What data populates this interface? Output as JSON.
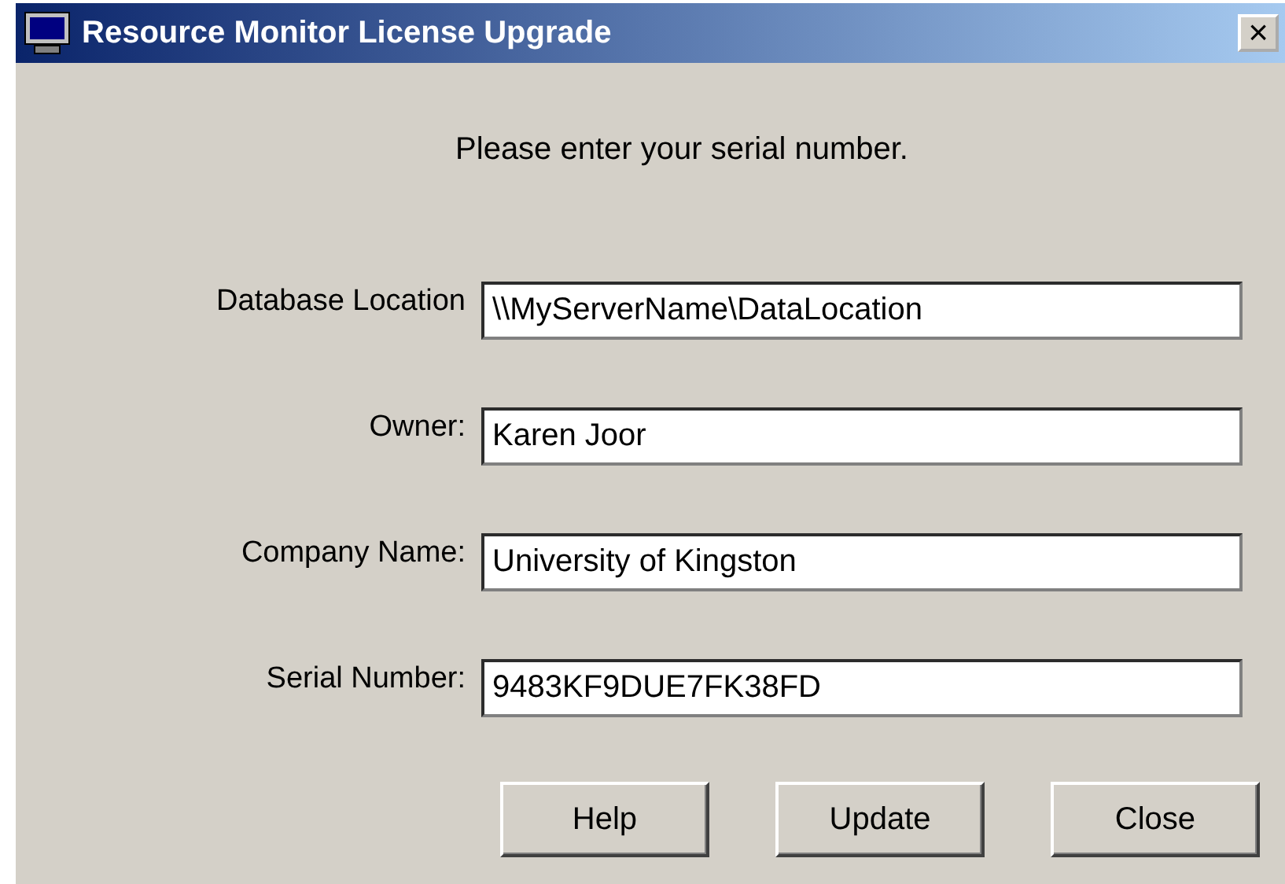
{
  "window": {
    "title": "Resource Monitor License Upgrade",
    "close": "×"
  },
  "prompt": "Please enter your serial number.",
  "fields": [
    {
      "label": "Database Location",
      "value": "\\\\MyServerName\\DataLocation"
    },
    {
      "label": "Owner:",
      "value": "Karen Joor"
    },
    {
      "label": "Company Name:",
      "value": "University of Kingston"
    },
    {
      "label": "Serial Number:",
      "value": "9483KF9DUE7FK38FD"
    }
  ],
  "buttons": [
    "Help",
    "Update",
    "Close"
  ]
}
